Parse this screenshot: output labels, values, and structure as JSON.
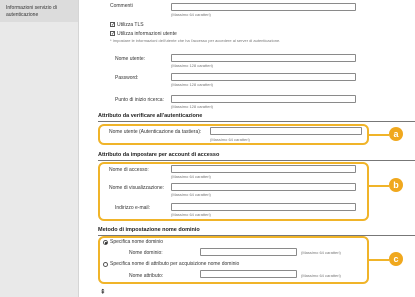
{
  "sidebar": {
    "items": [
      {
        "line1": "Informazioni servizio di",
        "line2": "autenticazione"
      }
    ]
  },
  "ldap": {
    "comments_label": "Commenti",
    "comments_hint": "(Massimo 64 caratteri)",
    "use_tls_label": "Utilizza TLS",
    "use_tls_checked": true,
    "use_user_info_label": "Utilizza informazioni utente",
    "use_user_info_checked": true,
    "note": "* Impostare le informazioni dell'utente che ha l'accesso per accedere al server di autenticazione.",
    "username_label": "Nome utente:",
    "username_hint": "(Massimo 128 caratteri)",
    "password_label": "Password:",
    "password_hint": "(Massimo 128 caratteri)",
    "search_start_label": "Punto di inizio ricerca:",
    "search_start_hint": "(Massimo 128 caratteri)"
  },
  "auth_attr": {
    "header": "Attributo da verificare all'autenticazione",
    "username_keys_label": "Nome utente (Autenticazione da tastiera):",
    "username_keys_hint": "(Massimo 64 caratteri)"
  },
  "access_attr": {
    "header": "Attributo da impostare per account di accesso",
    "login_name_label": "Nome di accesso:",
    "login_name_hint": "(Massimo 64 caratteri)",
    "display_name_label": "Nome di visualizzazione:",
    "display_name_hint": "(Massimo 64 caratteri)",
    "email_label": "Indirizzo e-mail:",
    "email_hint": "(Massimo 64 caratteri)"
  },
  "domain": {
    "header": "Metodo di impostazione nome dominio",
    "option1_label": "Specifica nome dominio",
    "option1_selected": true,
    "domain_name_label": "Nome dominio:",
    "domain_name_hint": "(Massimo 64 caratteri)",
    "option2_label": "Specifica nome di attributo per acquisizione nome dominio",
    "attr_name_label": "Nome attributo:",
    "attr_name_hint": "(Massimo 64 caratteri)"
  },
  "callouts": [
    "a",
    "b",
    "c"
  ],
  "colors": {
    "callout": "#f0a81e",
    "callout_border": "#f0b429"
  }
}
